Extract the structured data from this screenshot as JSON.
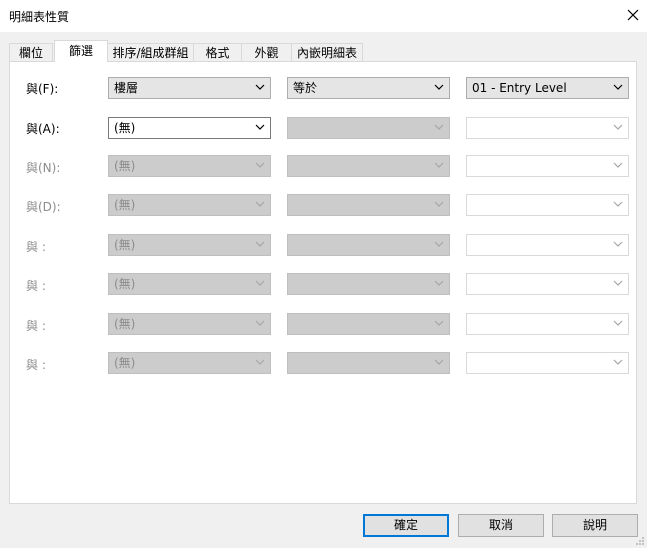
{
  "window": {
    "title": "明細表性質"
  },
  "tabs": [
    {
      "label": "欄位"
    },
    {
      "label": "篩選"
    },
    {
      "label": "排序/組成群組"
    },
    {
      "label": "格式"
    },
    {
      "label": "外觀"
    },
    {
      "label": "內嵌明細表"
    }
  ],
  "filters": [
    {
      "label": "與(F):",
      "field": "樓層",
      "operator": "等於",
      "value": "01 - Entry Level"
    },
    {
      "label": "與(A):",
      "field": "(無)",
      "operator": "",
      "value": ""
    },
    {
      "label": "與(N):",
      "field": "(無)",
      "operator": "",
      "value": ""
    },
    {
      "label": "與(D):",
      "field": "(無)",
      "operator": "",
      "value": ""
    },
    {
      "label": "與 :",
      "field": "(無)",
      "operator": "",
      "value": ""
    },
    {
      "label": "與 :",
      "field": "(無)",
      "operator": "",
      "value": ""
    },
    {
      "label": "與 :",
      "field": "(無)",
      "operator": "",
      "value": ""
    },
    {
      "label": "與 :",
      "field": "(無)",
      "operator": "",
      "value": ""
    }
  ],
  "buttons": {
    "ok": "確定",
    "cancel": "取消",
    "help": "說明"
  }
}
